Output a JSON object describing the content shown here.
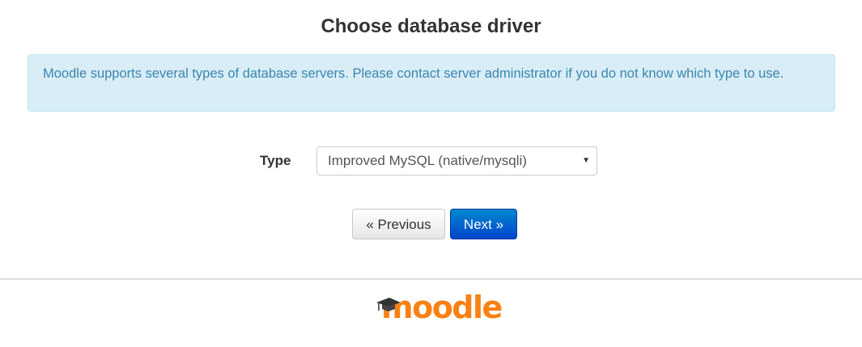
{
  "page": {
    "title": "Choose database driver"
  },
  "alert": {
    "message": "Moodle supports several types of database servers. Please contact server administrator if you do not know which type to use."
  },
  "form": {
    "type_label": "Type",
    "driver_select": {
      "selected": "Improved MySQL (native/mysqli)",
      "arrow_icon": "caret-down-icon"
    }
  },
  "buttons": {
    "previous_label": "« Previous",
    "next_label": "Next »"
  },
  "footer": {
    "logo_text": "moodle",
    "logo_icon": "graduation-cap-icon"
  },
  "colors": {
    "alert_bg": "#d9edf7",
    "alert_text": "#3a87ad",
    "primary": "#0055bb",
    "brand_orange": "#f98012"
  }
}
